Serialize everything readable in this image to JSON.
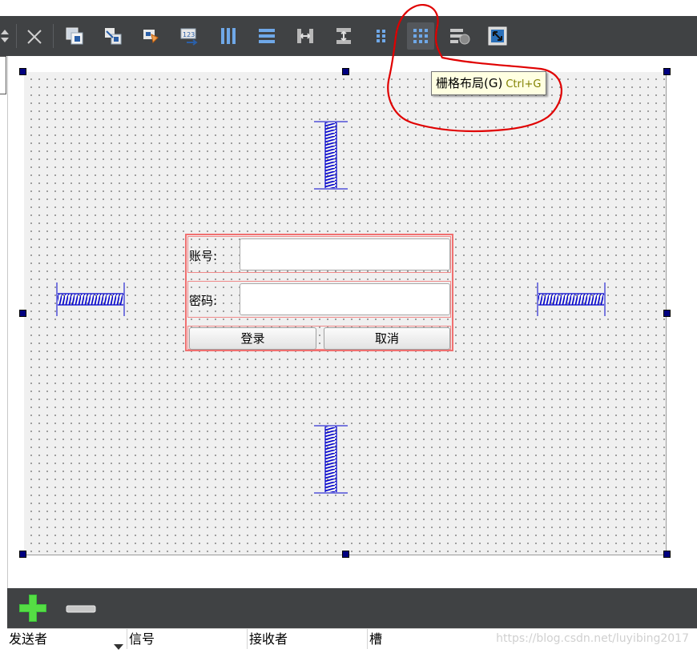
{
  "toolbar": {
    "items": [
      {
        "name": "edit-widgets",
        "icon": "edit-widgets-icon"
      },
      {
        "name": "edit-signals-slots",
        "icon": "signals-slots-icon"
      },
      {
        "name": "edit-buddies",
        "icon": "buddies-icon"
      },
      {
        "name": "edit-tab-order",
        "icon": "tab-order-icon"
      },
      {
        "name": "layout-horizontally",
        "icon": "horizontal-layout-icon"
      },
      {
        "name": "layout-vertically",
        "icon": "vertical-layout-icon"
      },
      {
        "name": "layout-horizontal-splitter",
        "icon": "horizontal-splitter-icon"
      },
      {
        "name": "layout-vertical-splitter",
        "icon": "vertical-splitter-icon"
      },
      {
        "name": "layout-form",
        "icon": "form-layout-icon"
      },
      {
        "name": "layout-grid",
        "icon": "grid-layout-icon"
      },
      {
        "name": "break-layout",
        "icon": "break-layout-icon"
      },
      {
        "name": "adjust-size",
        "icon": "adjust-size-icon"
      }
    ]
  },
  "tooltip": {
    "text": "栅格布局(G)",
    "shortcut": "Ctrl+G"
  },
  "form": {
    "account_label": "账号:",
    "account_value": "",
    "password_label": "密码:",
    "password_value": "",
    "login_label": "登录",
    "cancel_label": "取消"
  },
  "signal_slot_editor": {
    "add_icon": "plus-icon",
    "remove_icon": "minus-icon",
    "columns": [
      "发送者",
      "信号",
      "接收者",
      "槽"
    ]
  },
  "watermark": "https://blog.csdn.net/luyibing2017",
  "colors": {
    "toolbar_bg": "#404244",
    "handle": "#000080",
    "spacer": "#0000cc",
    "layout_border": "#f07070",
    "annotation": "#e00000"
  }
}
